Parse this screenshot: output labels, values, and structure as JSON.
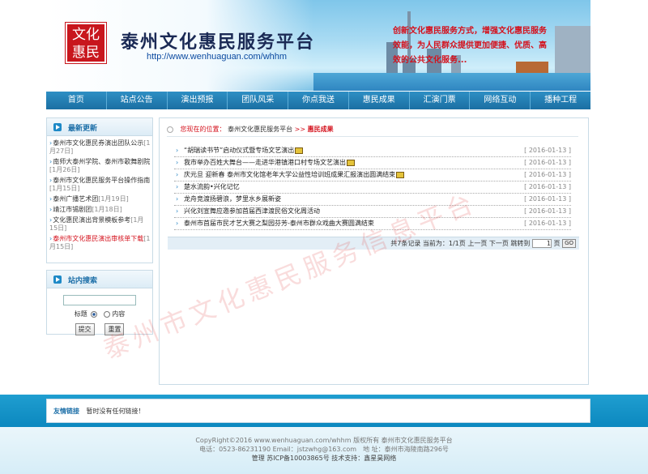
{
  "banner": {
    "logo_text": "文化惠民",
    "site_title": "泰州文化惠民服务平台",
    "site_url": "http://www.wenhuaguan.com/whhm",
    "slogan": "创新文化惠民服务方式，增强文化惠民服务效能，为人民群众提供更加便捷、优质、高效的公共文化服务..."
  },
  "nav": {
    "items": [
      "首页",
      "站点公告",
      "演出预报",
      "团队风采",
      "你点我送",
      "惠民成果",
      "汇演门票",
      "网络互动",
      "播种工程"
    ]
  },
  "sidebar": {
    "news_title": "最新更新",
    "news": [
      {
        "title": "泰州市文化惠民券演出团队公示",
        "date": "[1月27日]",
        "red": false
      },
      {
        "title": "南师大泰州学院、泰州市歌舞剧院",
        "date": "[1月26日]",
        "red": false
      },
      {
        "title": "泰州市文化惠民服务平台操作指南",
        "date": "[1月15日]",
        "red": false
      },
      {
        "title": "泰州广播艺术团",
        "date": "[1月19日]",
        "red": false
      },
      {
        "title": "靖江市锡剧团",
        "date": "[1月18日]",
        "red": false
      },
      {
        "title": "文化惠民演出背景模板参考",
        "date": "[1月15日]",
        "red": false
      },
      {
        "title": "泰州市文化惠民演出审核单下载",
        "date": "[1月15日]",
        "red": true
      }
    ],
    "search_title": "站内搜索",
    "radio_title": "标题",
    "radio_content": "内容",
    "submit_label": "提交",
    "reset_label": "重置"
  },
  "main": {
    "crumb_prefix": "您现在的位置：",
    "crumb_site": "泰州文化惠民服务平台",
    "crumb_sep": ">>",
    "crumb_current": "惠民成果",
    "articles": [
      {
        "title": "“胡瑞读书节”启动仪式暨专场文艺演出",
        "date": "[ 2016-01-13 ]",
        "new": true
      },
      {
        "title": "我市举办百姓大舞台——走进华港镇港口村专场文艺演出",
        "date": "[ 2016-01-13 ]",
        "new": true
      },
      {
        "title": "庆元旦 迎新春 泰州市文化馆老年大学公益性培训班成果汇报演出圆满结束",
        "date": "[ 2016-01-13 ]",
        "new": true
      },
      {
        "title": "楚水流韵•兴化记忆",
        "date": "[ 2016-01-13 ]",
        "new": false
      },
      {
        "title": "龙舟竞渡扬碧浪，梦里水乡展新姿",
        "date": "[ 2016-01-13 ]",
        "new": false
      },
      {
        "title": "兴化刘宣舞应邀参加首届西津渡民俗文化周活动",
        "date": "[ 2016-01-13 ]",
        "new": false
      },
      {
        "title": "泰州市首届市民才艺大赛之梨园芬芳-泰州市群众戏曲大赛圆满结束",
        "date": "[ 2016-01-13 ]",
        "new": false
      }
    ],
    "pager": {
      "summary": "共7条记录 当前为：1/1页",
      "prev": "上一页",
      "next": "下一页",
      "jump_label": "跳转到",
      "page_value": "1",
      "page_suffix": "页",
      "go_label": "GO"
    }
  },
  "watermark": "泰州市文化惠民服务信息平台",
  "links": {
    "title": "友情链接",
    "empty_text": "暂时没有任何链接！"
  },
  "footer": {
    "line1": "CopyRight©2016 www.wenhuaguan.com/whhm 版权所有 泰州市文化惠民服务平台",
    "line2": "电话：0523-86231190 Email：jstzwhg@163.com　地 址：泰州市海陵南路296号",
    "line3": "管理 苏ICP备10003865号 技术支持：鑫星昊网络"
  }
}
